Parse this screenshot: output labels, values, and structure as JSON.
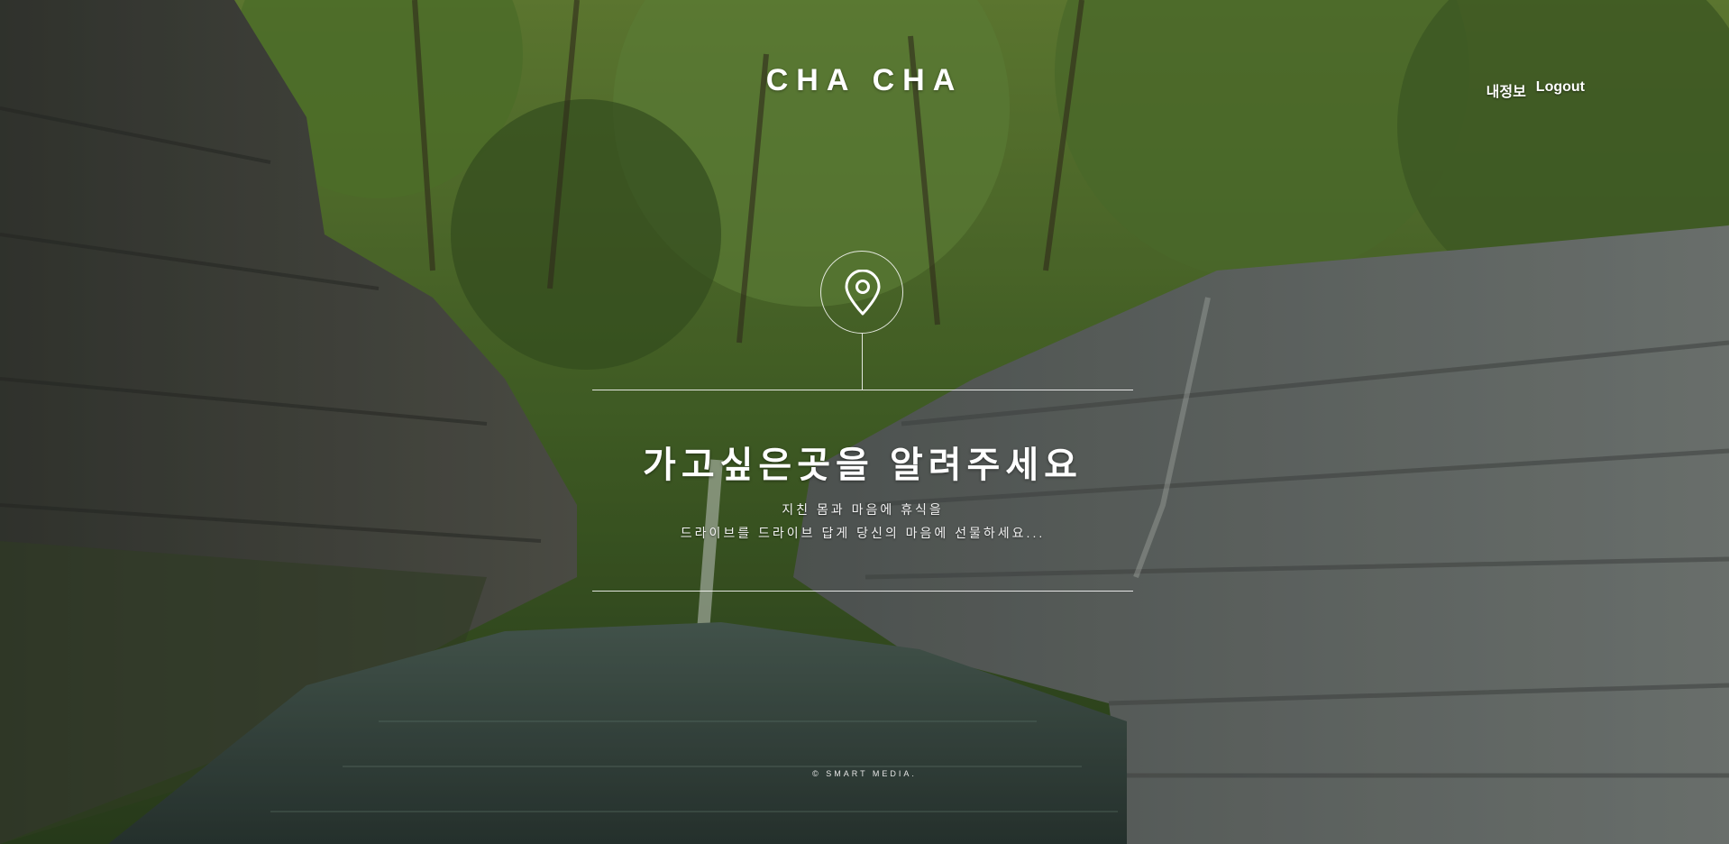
{
  "header": {
    "brand": "CHA CHA",
    "nav": {
      "my_info": "내정보",
      "logout": "Logout"
    }
  },
  "hero": {
    "icon": "location-pin-icon",
    "title": "가고싶은곳을 알려주세요",
    "subtitle_line1": "지친 몸과 마음에 휴식을",
    "subtitle_line2": "드라이브를 드라이브 답게 당신의 마음에 선물하세요..."
  },
  "footer": {
    "copyright": "© SMART MEDIA."
  },
  "colors": {
    "text": "#ffffff",
    "foliage": "#4f7a2a",
    "rock": "#5b605c",
    "water": "#3f5b52"
  }
}
